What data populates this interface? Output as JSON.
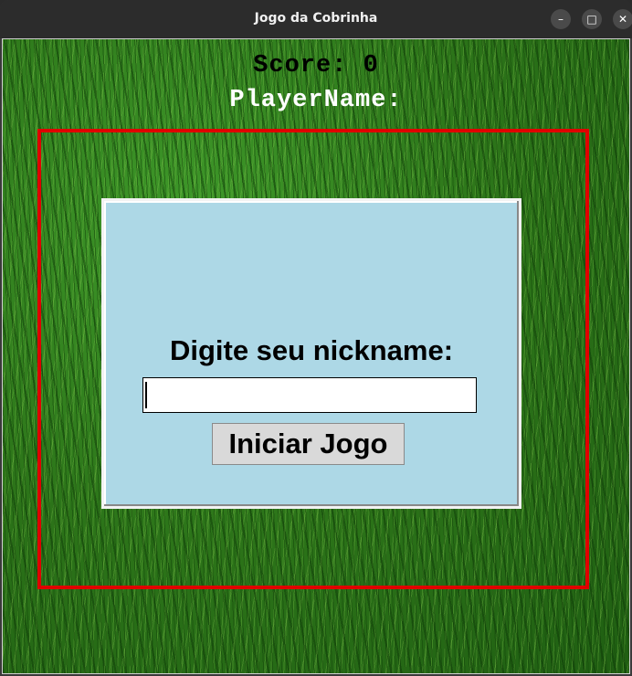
{
  "window": {
    "title": "Jogo da Cobrinha",
    "controls": {
      "minimize": "–",
      "maximize": "□",
      "close": "✕"
    }
  },
  "game": {
    "score_text": "Score: 0",
    "player_text": "PlayerName:",
    "colors": {
      "border": "#e00000",
      "dialog_bg": "#add8e6",
      "grass": "#2f7d1f"
    }
  },
  "dialog": {
    "prompt": "Digite seu nickname:",
    "nickname_value": "",
    "start_label": "Iniciar Jogo"
  }
}
